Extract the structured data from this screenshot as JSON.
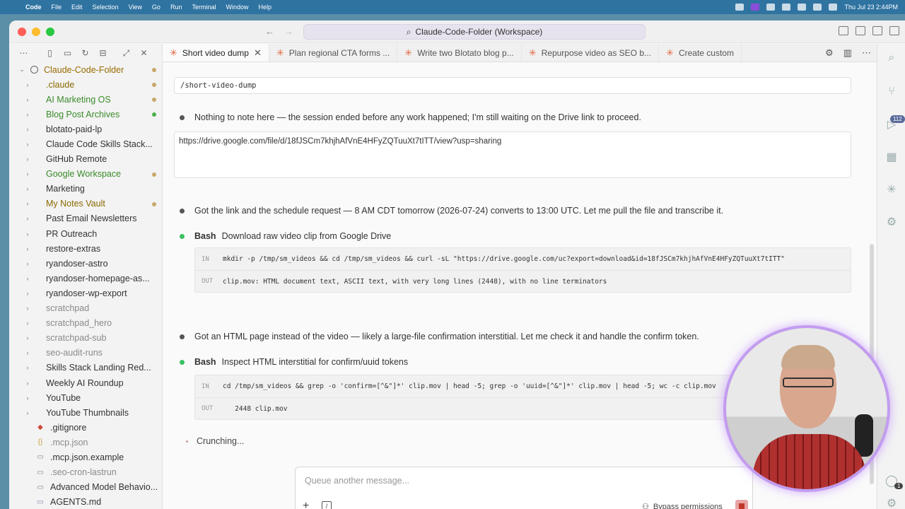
{
  "menubar": {
    "app": "Code",
    "items": [
      "File",
      "Edit",
      "Selection",
      "View",
      "Go",
      "Run",
      "Terminal",
      "Window",
      "Help"
    ],
    "clock": "Thu Jul 23  2:44PM"
  },
  "window": {
    "search_title": "Claude-Code-Folder (Workspace)"
  },
  "sidebar": {
    "root": "Claude-Code-Folder",
    "items": [
      {
        "name": ".claude",
        "type": "folder",
        "color": "c-yellow",
        "dot": "#c8a868",
        "icon": "folder"
      },
      {
        "name": "AI Marketing OS",
        "type": "folder",
        "color": "c-green",
        "dot": "#c8a868"
      },
      {
        "name": "Blog Post Archives",
        "type": "folder",
        "color": "c-green",
        "dot": "#4ab04a"
      },
      {
        "name": "blotato-paid-lp",
        "type": "folder",
        "color": "c-dark"
      },
      {
        "name": "Claude Code Skills Stack...",
        "type": "folder",
        "color": "c-dark"
      },
      {
        "name": "GitHub Remote",
        "type": "folder",
        "color": "c-dark"
      },
      {
        "name": "Google Workspace",
        "type": "folder",
        "color": "c-green",
        "dot": "#c8a868"
      },
      {
        "name": "Marketing",
        "type": "folder",
        "color": "c-dark"
      },
      {
        "name": "My Notes Vault",
        "type": "folder",
        "color": "c-yellow",
        "dot": "#c8a868"
      },
      {
        "name": "Past Email Newsletters",
        "type": "folder",
        "color": "c-dark"
      },
      {
        "name": "PR Outreach",
        "type": "folder",
        "color": "c-dark"
      },
      {
        "name": "restore-extras",
        "type": "folder",
        "color": "c-dark"
      },
      {
        "name": "ryandoser-astro",
        "type": "folder",
        "color": "c-dark"
      },
      {
        "name": "ryandoser-homepage-as...",
        "type": "folder",
        "color": "c-dark"
      },
      {
        "name": "ryandoser-wp-export",
        "type": "folder",
        "color": "c-dark"
      },
      {
        "name": "scratchpad",
        "type": "folder",
        "color": "c-gray"
      },
      {
        "name": "scratchpad_hero",
        "type": "folder",
        "color": "c-gray"
      },
      {
        "name": "scratchpad-sub",
        "type": "folder",
        "color": "c-gray"
      },
      {
        "name": "seo-audit-runs",
        "type": "folder",
        "color": "c-gray"
      },
      {
        "name": "Skills Stack Landing Red...",
        "type": "folder",
        "color": "c-dark"
      },
      {
        "name": "Weekly AI Roundup",
        "type": "folder",
        "color": "c-dark"
      },
      {
        "name": "YouTube",
        "type": "folder",
        "color": "c-dark"
      },
      {
        "name": "YouTube Thumbnails",
        "type": "folder",
        "color": "c-dark"
      },
      {
        "name": ".gitignore",
        "type": "file",
        "color": "c-dark",
        "glyph": "◆",
        "glyph_color": "#d04a3a"
      },
      {
        "name": ".mcp.json",
        "type": "file",
        "color": "c-gray",
        "glyph": "{}",
        "glyph_color": "#c8a040"
      },
      {
        "name": ".mcp.json.example",
        "type": "file",
        "color": "c-dark",
        "glyph": "▭",
        "glyph_color": "#7a8aa0"
      },
      {
        "name": ".seo-cron-lastrun",
        "type": "file",
        "color": "c-gray",
        "glyph": "▭",
        "glyph_color": "#7a8aa0"
      },
      {
        "name": "Advanced Model Behavio...",
        "type": "file",
        "color": "c-dark",
        "glyph": "▭",
        "glyph_color": "#7a8aa0"
      },
      {
        "name": "AGENTS.md",
        "type": "file",
        "color": "c-dark",
        "glyph": "▭",
        "glyph_color": "#7a8aa0"
      }
    ]
  },
  "tabs": [
    {
      "label": "Short video dump",
      "active": true
    },
    {
      "label": "Plan regional CTA forms ...",
      "active": false
    },
    {
      "label": "Write two Blotato blog p...",
      "active": false
    },
    {
      "label": "Repurpose video as SEO b...",
      "active": false
    },
    {
      "label": "Create custom",
      "active": false
    }
  ],
  "chat": {
    "command": "/short-video-dump",
    "msg1": "Nothing to note here — the session ended before any work happened; I'm still waiting on the Drive link to proceed.",
    "url": "https://drive.google.com/file/d/18fJSCm7khjhAfVnE4HFyZQTuuXt7tITT/view?usp=sharing",
    "msg2": "Got the link and the schedule request — 8 AM CDT tomorrow (2026-07-24) converts to 13:00 UTC. Let me pull the file and transcribe it.",
    "bash1": {
      "label": "Bash",
      "desc": "Download raw video clip from Google Drive",
      "in_tag": "IN",
      "in": "mkdir -p /tmp/sm_videos && cd /tmp/sm_videos && curl -sL \"https://drive.google.com/uc?export=download&id=18fJSCm7khjhAfVnE4HFyZQTuuXt7tITT\"",
      "out_tag": "OUT",
      "out": "clip.mov: HTML document text, ASCII text, with very long lines (2448), with no line terminators"
    },
    "msg3": "Got an HTML page instead of the video — likely a large-file confirmation interstitial. Let me check it and handle the confirm token.",
    "bash2": {
      "label": "Bash",
      "desc": "Inspect HTML interstitial for confirm/uuid tokens",
      "in_tag": "IN",
      "in": "cd /tmp/sm_videos && grep -o 'confirm=[^&\"]*' clip.mov | head -5; grep -o 'uuid=[^&\"]*' clip.mov | head -5; wc -c clip.mov",
      "out_tag": "OUT",
      "out": "   2448 clip.mov"
    },
    "status": "Crunching..."
  },
  "composer": {
    "placeholder": "Queue another message...",
    "permissions": "Bypass permissions"
  },
  "activity": {
    "badge": "112",
    "badge2": "1"
  },
  "colors": {
    "accent_tab_star": "#e2633d",
    "bash_dot": "#3ac060",
    "webcam_ring": "#c39cf0"
  }
}
